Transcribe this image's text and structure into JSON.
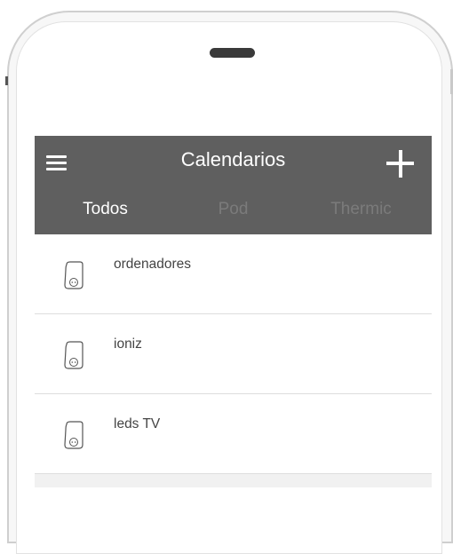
{
  "header": {
    "title": "Calendarios",
    "background": "#5f5f5f"
  },
  "tabs": [
    {
      "label": "Todos",
      "active": true
    },
    {
      "label": "Pod",
      "active": false
    },
    {
      "label": "Thermic",
      "active": false
    }
  ],
  "calendars": [
    {
      "name": "ordenadores",
      "icon": "plug-device-icon"
    },
    {
      "name": "ioniz",
      "icon": "plug-device-icon"
    },
    {
      "name": "leds TV",
      "icon": "plug-device-icon"
    }
  ]
}
